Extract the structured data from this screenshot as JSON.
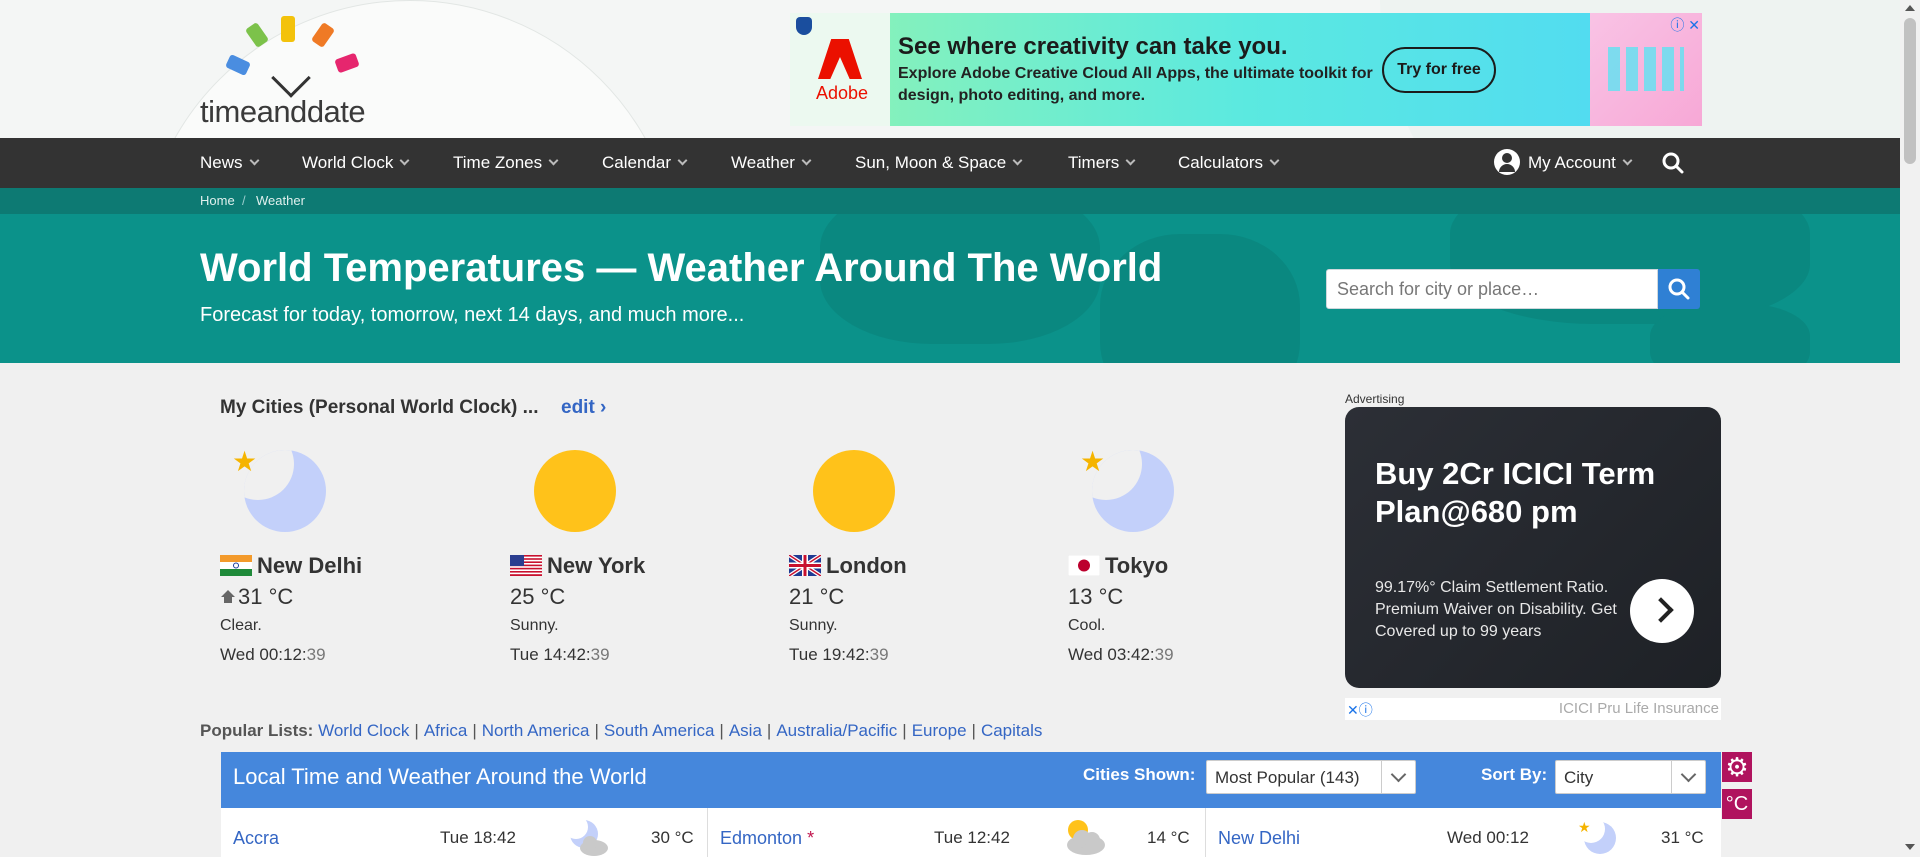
{
  "logo": {
    "text_a": "time",
    "text_b": "and",
    "text_c": "date"
  },
  "top_ad": {
    "brand": "Adobe",
    "headline": "See where creativity can take you.",
    "body": "Explore Adobe Creative Cloud All Apps, the ultimate toolkit for design, photo editing, and more.",
    "cta": "Try for free"
  },
  "nav": {
    "items": [
      {
        "label": "News"
      },
      {
        "label": "World Clock"
      },
      {
        "label": "Time Zones"
      },
      {
        "label": "Calendar"
      },
      {
        "label": "Weather"
      },
      {
        "label": "Sun, Moon & Space"
      },
      {
        "label": "Timers"
      },
      {
        "label": "Calculators"
      }
    ],
    "account": "My Account",
    "search_icon": "search-icon"
  },
  "breadcrumb": {
    "home": "Home",
    "sep": "/",
    "current": "Weather"
  },
  "hero": {
    "title": "World Temperatures — Weather Around The World",
    "subtitle": "Forecast for today, tomorrow, next 14 days, and much more...",
    "search_placeholder": "Search for city or place…"
  },
  "my_cities": {
    "title": "My Cities (Personal World Clock) ...",
    "edit": "edit ›",
    "cities": [
      {
        "name": "New Delhi",
        "icon": "moon-star",
        "temp": "31 °C",
        "desc": "Clear.",
        "time": "Wed 00:12:",
        "sec": "39",
        "home": true
      },
      {
        "name": "New York",
        "icon": "sun",
        "temp": "25 °C",
        "desc": "Sunny.",
        "time": "Tue 14:42:",
        "sec": "39"
      },
      {
        "name": "London",
        "icon": "sun",
        "temp": "21 °C",
        "desc": "Sunny.",
        "time": "Tue 19:42:",
        "sec": "39"
      },
      {
        "name": "Tokyo",
        "icon": "moon-star",
        "temp": "13 °C",
        "desc": "Cool.",
        "time": "Wed 03:42:",
        "sec": "39"
      }
    ]
  },
  "side_ad": {
    "label": "Advertising",
    "headline": "Buy 2Cr ICICI Term Plan@680 pm",
    "body": "99.17%° Claim Settlement Ratio. Premium Waiver on Disability. Get Covered up to 99 years",
    "brand": "ICICI Pru Life Insurance"
  },
  "popular": {
    "label": "Popular Lists:",
    "links": [
      "World Clock",
      "Africa",
      "North America",
      "South America",
      "Asia",
      "Australia/Pacific",
      "Europe",
      "Capitals"
    ]
  },
  "table": {
    "title": "Local Time and Weather Around the World",
    "cities_shown_label": "Cities Shown:",
    "cities_shown_value": "Most Popular (143)",
    "sort_by_label": "Sort By:",
    "sort_by_value": "City",
    "unit_button": "°C",
    "rows": [
      {
        "city": "Accra",
        "asterisk": "",
        "time": "Tue 18:42",
        "icon": "moon-cloud",
        "temp": "30 °C"
      },
      {
        "city": "Edmonton",
        "asterisk": "*",
        "time": "Tue 12:42",
        "icon": "sun-cloud",
        "temp": "14 °C"
      },
      {
        "city": "New Delhi",
        "asterisk": "",
        "time": "Wed 00:12",
        "icon": "moon-star",
        "temp": "31 °C"
      }
    ]
  },
  "colors": {
    "nav_bg": "#333333",
    "hero_bg": "#0b928a",
    "table_head": "#4587dc",
    "link": "#3466c4",
    "accent_magenta": "#b0135e",
    "sun": "#ffc21a",
    "moon": "#c3d0fa"
  }
}
